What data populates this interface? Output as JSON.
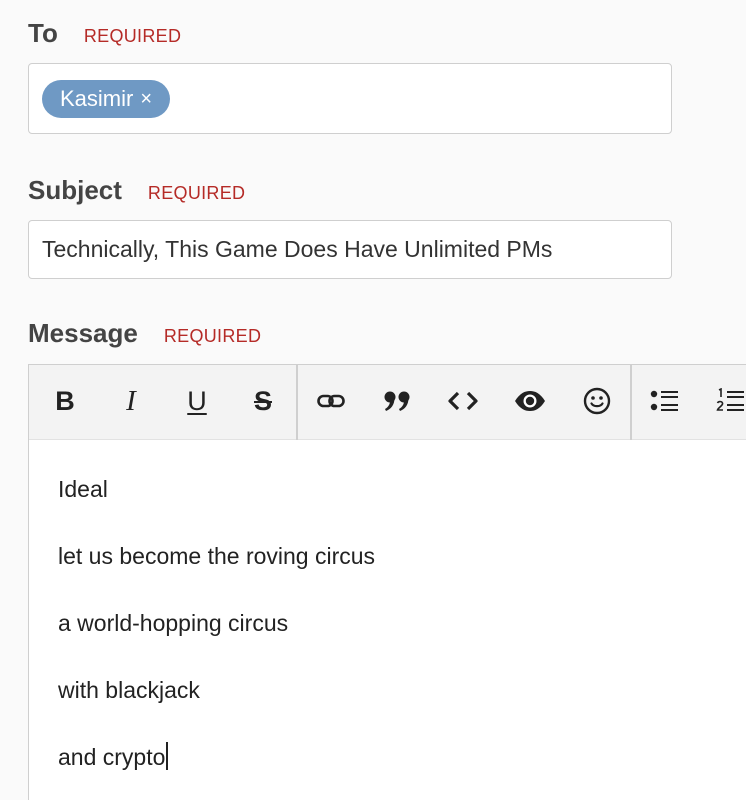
{
  "to": {
    "label": "To",
    "required": "REQUIRED",
    "recipients": [
      {
        "name": "Kasimir",
        "remove": "×"
      }
    ]
  },
  "subject": {
    "label": "Subject",
    "required": "REQUIRED",
    "value": "Technically, This Game Does Have Unlimited PMs"
  },
  "message": {
    "label": "Message",
    "required": "REQUIRED",
    "toolbar": {
      "bold": "B",
      "italic": "I",
      "underline": "U",
      "strike": "S",
      "icons": [
        "link-icon",
        "quote-icon",
        "code-icon",
        "preview-eye-icon",
        "emoji-icon",
        "bullet-list-icon",
        "numbered-list-icon"
      ]
    },
    "lines": [
      "Ideal",
      "let us become the roving circus",
      "a world-hopping circus",
      "with blackjack",
      "and crypto"
    ]
  }
}
